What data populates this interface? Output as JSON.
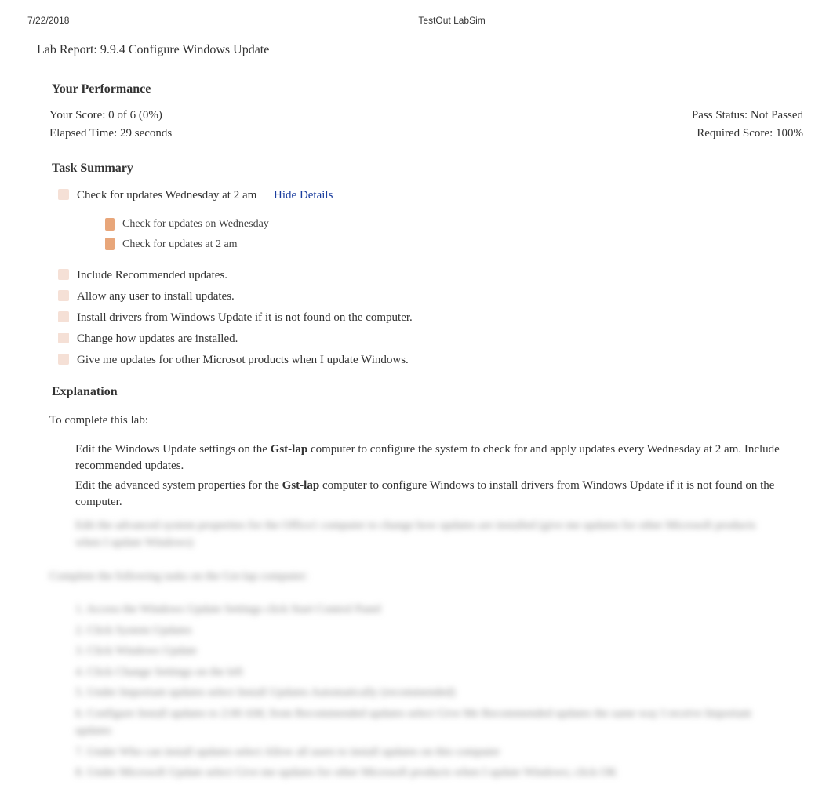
{
  "header": {
    "date": "7/22/2018",
    "product": "TestOut LabSim"
  },
  "lab_title": "Lab Report: 9.9.4 Configure Windows Update",
  "performance": {
    "heading": "Your Performance",
    "score_label": "Your Score: 0 of 6 (0%)",
    "pass_status": "Pass Status: Not Passed",
    "elapsed_time": "Elapsed Time: 29 seconds",
    "required_score": "Required Score: 100%"
  },
  "task_summary": {
    "heading": "Task Summary",
    "task1": {
      "text": "Check for updates Wednesday at 2 am",
      "hide_details": "Hide Details",
      "details": [
        "Check for updates on Wednesday",
        "Check for updates at 2 am"
      ]
    },
    "tasks": [
      "Include Recommended updates.",
      "Allow any user to install updates.",
      "Install drivers from Windows Update if it is not found on the computer.",
      "Change how updates are installed.",
      "Give me updates for other Microsot products when I update Windows."
    ]
  },
  "explanation": {
    "heading": "Explanation",
    "intro": "To complete this lab:",
    "bullets": [
      {
        "prefix": "Edit the Windows Update settings on the ",
        "computer": "Gst-lap",
        "suffix": " computer to configure the system to check for and apply updates every Wednesday at 2 am. Include recommended updates."
      },
      {
        "prefix": "Edit the advanced system properties for the ",
        "computer": "Gst-lap",
        "suffix": " computer to configure Windows to install drivers from Windows Update if it is not found on the computer."
      }
    ],
    "blurred": {
      "bullet3": "Edit the advanced system properties for the Office1 computer to change how updates are installed (give me updates for other Microsoft products when I update Windows)",
      "intro": "Complete the following tasks on the Gst-lap computer:",
      "steps": [
        "1. Access the Windows Update Settings click Start Control Panel",
        "2. Click System Updates",
        "3. Click Windows Update",
        "4. Click Change Settings on the left",
        "5. Under Important updates select Install Updates Automatically (recommended)",
        "6. Configure Install updates to 2:00 AM; from Recommended updates select Give Me Recommended updates the same way I receive Important updates",
        "7. Under Who can install updates select Allow all users to install updates on this computer",
        "8. Under Microsoft Update select Give me updates for other Microsoft products when I update Windows; click OK"
      ]
    }
  }
}
